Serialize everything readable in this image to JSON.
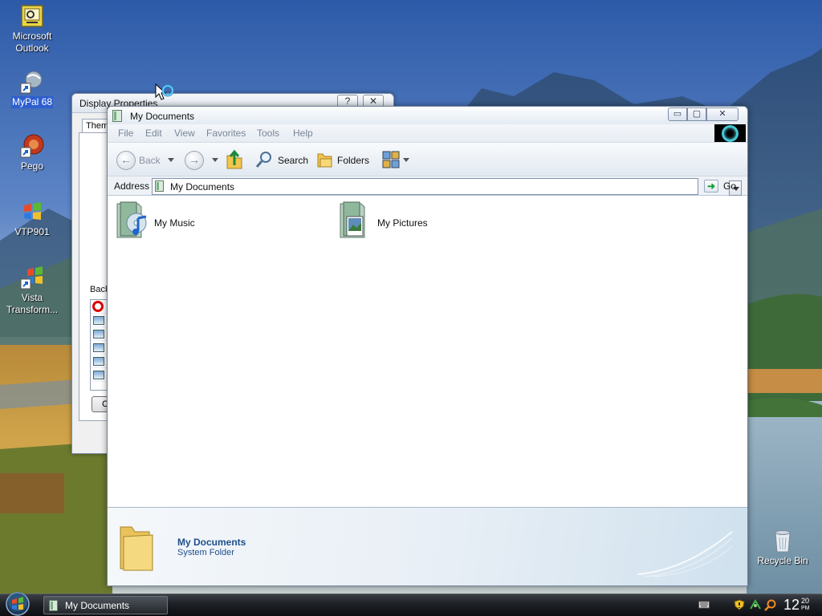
{
  "desktop": {
    "icons": [
      {
        "label": "Microsoft Outlook"
      },
      {
        "label": "MyPal 68"
      },
      {
        "label": "Pego"
      },
      {
        "label": "VTP901"
      },
      {
        "label": "Vista Transform..."
      },
      {
        "label": "Recycle Bin"
      }
    ]
  },
  "display_properties": {
    "title": "Display Properties",
    "help_label": "?",
    "close_label": "✕",
    "tab_label": "Theme",
    "back_label": "Back",
    "small_button_label": "C"
  },
  "my_documents": {
    "title": "My Documents",
    "controls": {
      "minimize": "▭",
      "maximize": "▢",
      "close": "✕"
    },
    "menu": [
      "File",
      "Edit",
      "View",
      "Favorites",
      "Tools",
      "Help"
    ],
    "toolbar": {
      "back_label": "Back",
      "search_label": "Search",
      "folders_label": "Folders"
    },
    "address": {
      "label": "Address",
      "value": "My Documents",
      "go_label": "Go"
    },
    "items": [
      {
        "name": "My Music"
      },
      {
        "name": "My Pictures"
      }
    ],
    "details": {
      "name": "My Documents",
      "type": "System Folder"
    }
  },
  "taskbar": {
    "task_label": "My Documents",
    "clock": {
      "hour": "12",
      "minute": "20",
      "ampm": "PM"
    }
  }
}
